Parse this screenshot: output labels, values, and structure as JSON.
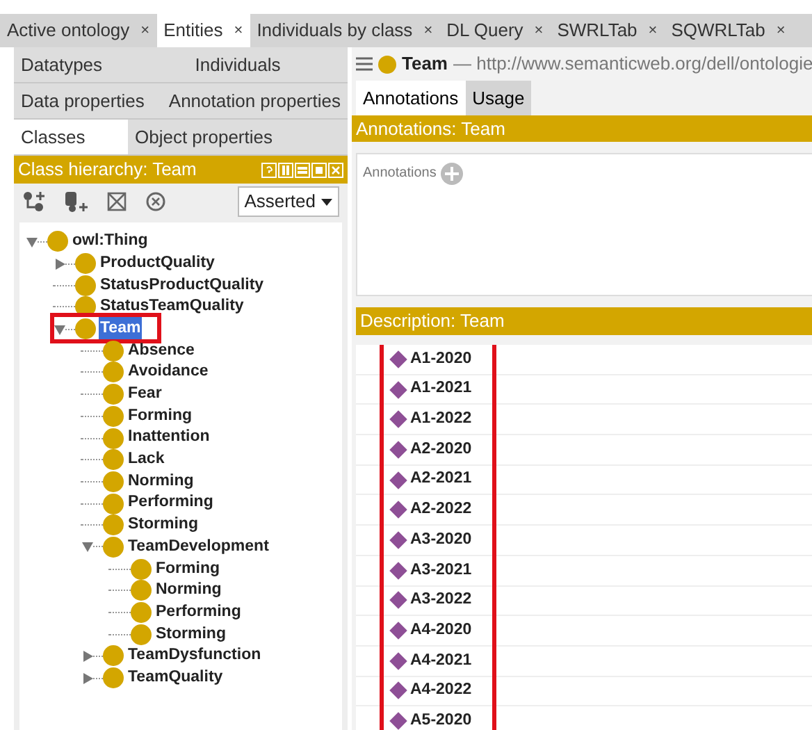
{
  "tabs": [
    {
      "label": "Active ontology",
      "close": "×",
      "selected": false
    },
    {
      "label": "Entities",
      "close": "×",
      "selected": true
    },
    {
      "label": "Individuals by class",
      "close": "×",
      "selected": false
    },
    {
      "label": "DL Query",
      "close": "×",
      "selected": false
    },
    {
      "label": "SWRLTab",
      "close": "×",
      "selected": false
    },
    {
      "label": "SQWRLTab",
      "close": "×",
      "selected": false
    }
  ],
  "entity_tabs": [
    [
      {
        "label": "Datatypes",
        "selected": false
      },
      {
        "label": "Individuals",
        "selected": false
      }
    ],
    [
      {
        "label": "Data properties",
        "selected": false
      },
      {
        "label": "Annotation properties",
        "selected": false
      }
    ],
    [
      {
        "label": "Classes",
        "selected": true
      },
      {
        "label": "Object properties",
        "selected": false
      }
    ]
  ],
  "class_hierarchy": {
    "title": "Class hierarchy: Team",
    "mode": "Asserted",
    "tree": [
      {
        "label": "owl:Thing",
        "expanded": true,
        "children": [
          {
            "label": "ProductQuality",
            "expanded": false
          },
          {
            "label": "StatusProductQuality"
          },
          {
            "label": "StatusTeamQuality"
          },
          {
            "label": "Team",
            "expanded": true,
            "selected": true,
            "highlighted": true,
            "children": [
              {
                "label": "Absence"
              },
              {
                "label": "Avoidance"
              },
              {
                "label": "Fear"
              },
              {
                "label": "Forming"
              },
              {
                "label": "Inattention"
              },
              {
                "label": "Lack"
              },
              {
                "label": "Norming"
              },
              {
                "label": "Performing"
              },
              {
                "label": "Storming"
              },
              {
                "label": "TeamDevelopment",
                "expanded": true,
                "children": [
                  {
                    "label": "Forming"
                  },
                  {
                    "label": "Norming"
                  },
                  {
                    "label": "Performing"
                  },
                  {
                    "label": "Storming"
                  }
                ]
              },
              {
                "label": "TeamDysfunction",
                "expanded": false
              },
              {
                "label": "TeamQuality",
                "expanded": false
              }
            ]
          }
        ]
      }
    ]
  },
  "entity": {
    "name": "Team",
    "iri": "— http://www.semanticweb.org/dell/ontologie"
  },
  "view_tabs": [
    {
      "label": "Annotations",
      "selected": true
    },
    {
      "label": "Usage",
      "selected": false
    }
  ],
  "annotations": {
    "title": "Annotations: Team",
    "label": "Annotations"
  },
  "description": {
    "title": "Description: Team",
    "highlighted": true,
    "individuals": [
      "A1-2020",
      "A1-2021",
      "A1-2022",
      "A2-2020",
      "A2-2021",
      "A2-2022",
      "A3-2020",
      "A3-2021",
      "A3-2022",
      "A4-2020",
      "A4-2021",
      "A4-2022",
      "A5-2020"
    ]
  }
}
